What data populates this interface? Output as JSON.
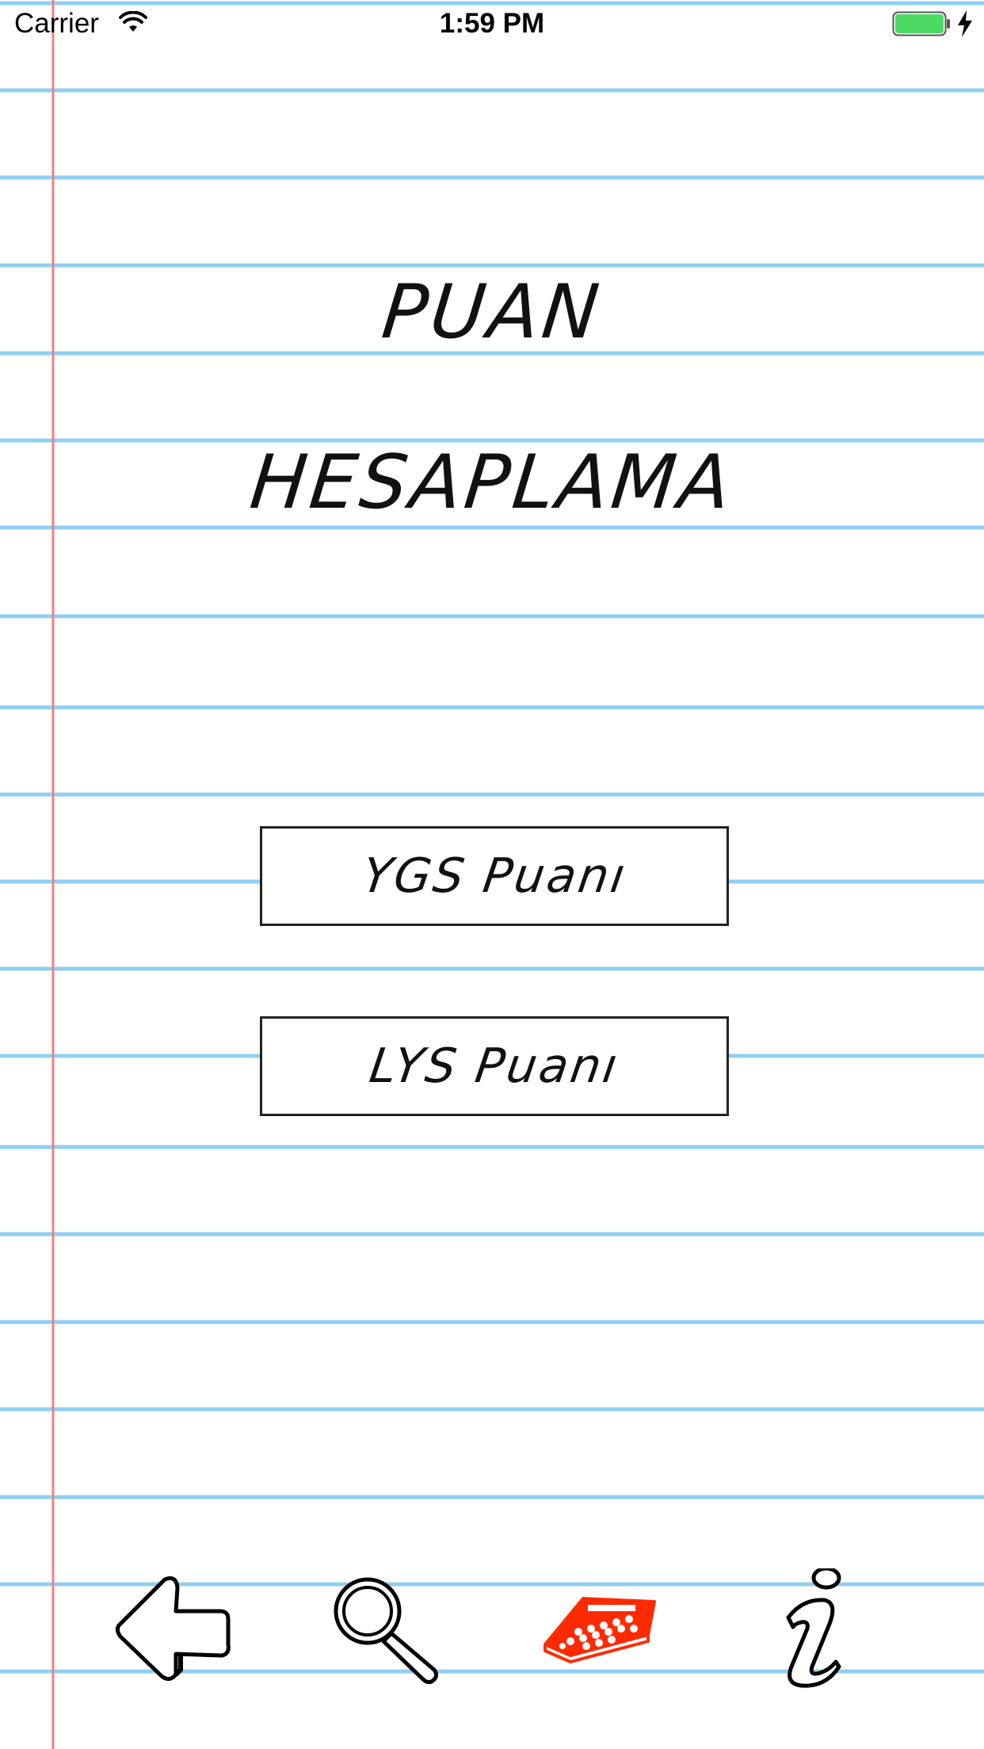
{
  "status_bar": {
    "carrier": "Carrier",
    "time": "1:59 PM",
    "battery_color": "#4cd964"
  },
  "title": {
    "line1": "PUAN",
    "line2": "HESAPLAMA"
  },
  "menu": {
    "ygs_label": "YGS Puanı",
    "lys_label": "LYS Puanı"
  },
  "tab_bar": {
    "items": [
      {
        "icon": "back-arrow-icon",
        "active": false
      },
      {
        "icon": "magnifier-icon",
        "active": false
      },
      {
        "icon": "calculator-icon",
        "active": true
      },
      {
        "icon": "info-icon",
        "active": false
      }
    ],
    "active_color": "#ff2a00",
    "inactive_color": "#000000"
  },
  "paper": {
    "rule_color": "#8fcff2",
    "margin_color": "#f08080"
  }
}
